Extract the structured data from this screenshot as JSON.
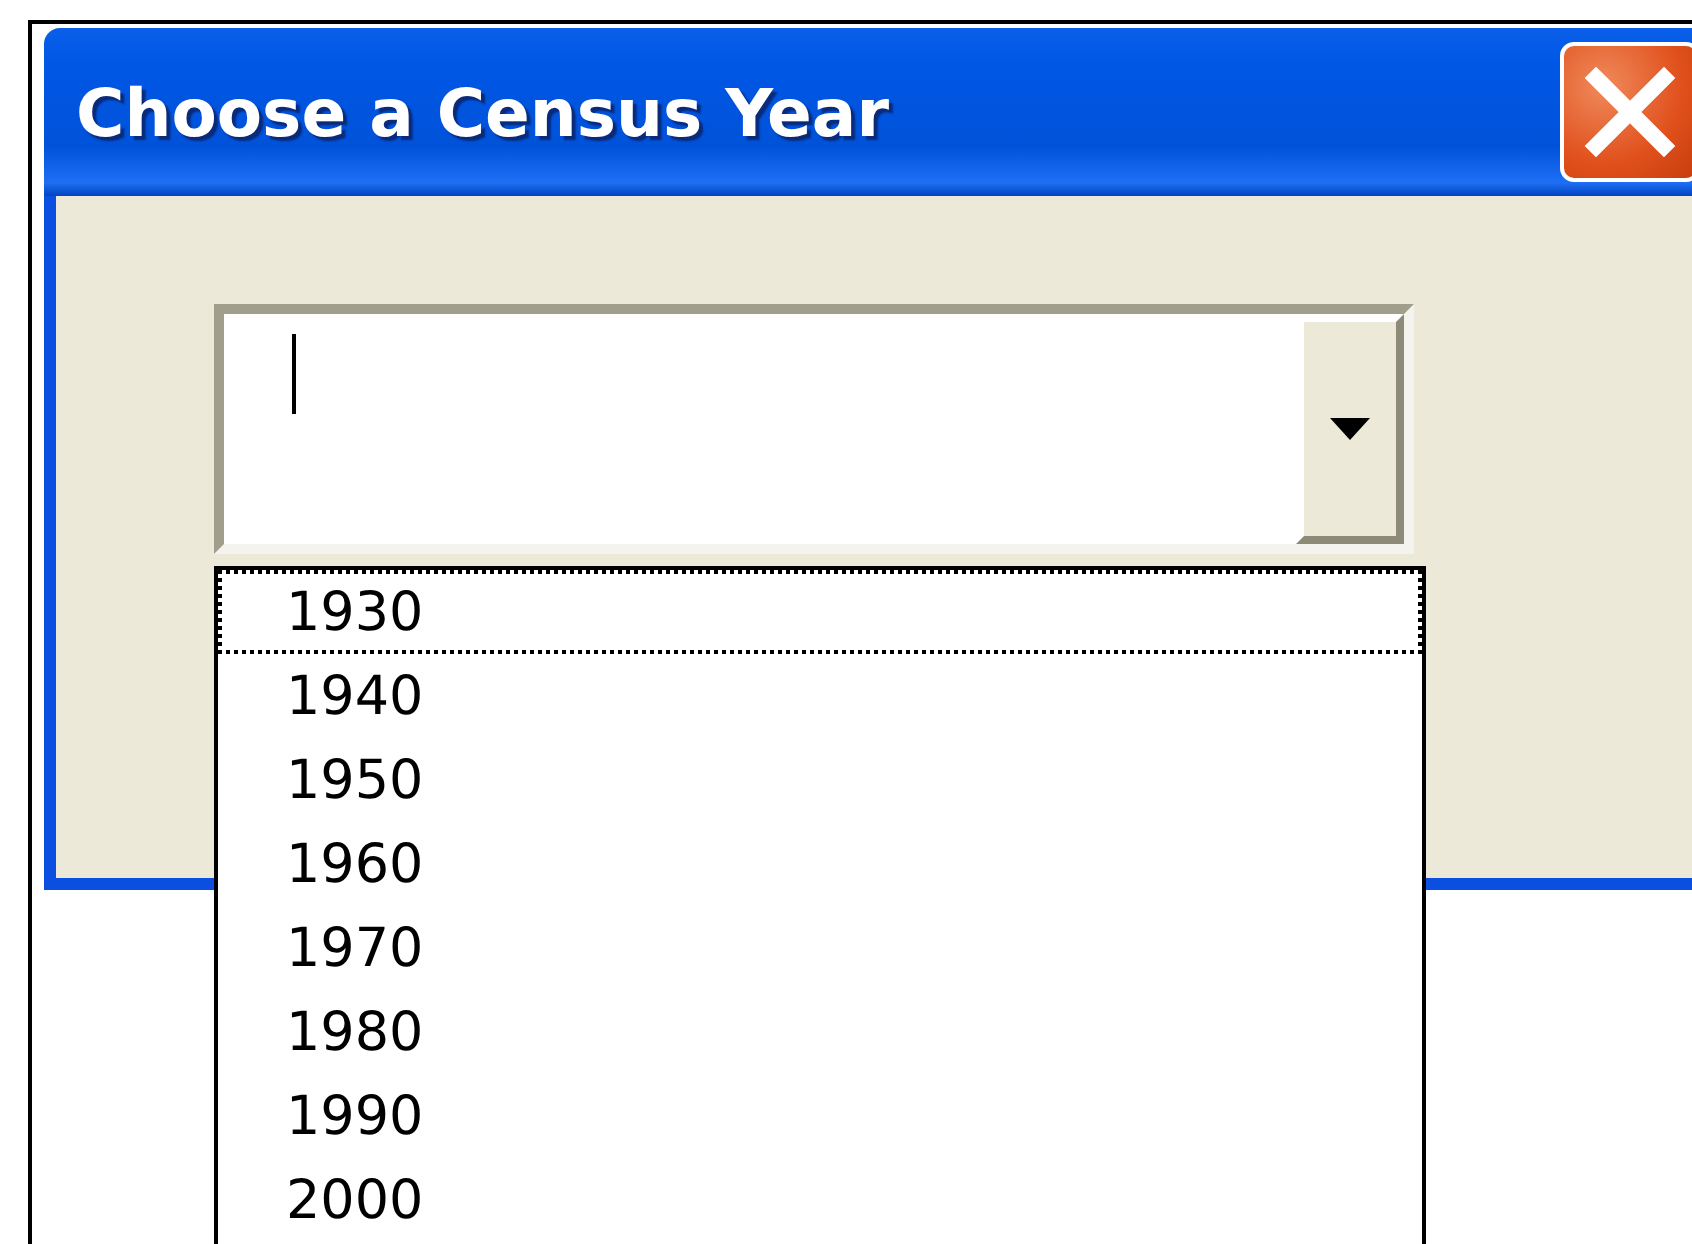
{
  "window": {
    "title": "Choose a Census Year"
  },
  "combo": {
    "expanded": true
  },
  "options": [
    {
      "label": "1930",
      "focused": true
    },
    {
      "label": "1940",
      "focused": false
    },
    {
      "label": "1950",
      "focused": false
    },
    {
      "label": "1960",
      "focused": false
    },
    {
      "label": "1970",
      "focused": false
    },
    {
      "label": "1980",
      "focused": false
    },
    {
      "label": "1990",
      "focused": false
    },
    {
      "label": "2000",
      "focused": false
    }
  ]
}
